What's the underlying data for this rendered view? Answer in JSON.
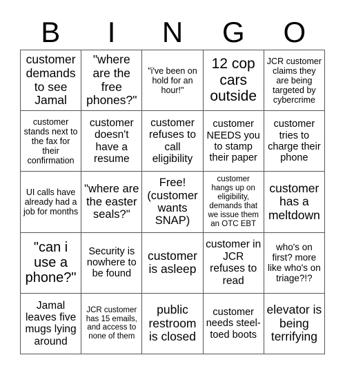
{
  "header": {
    "letters": [
      "B",
      "I",
      "N",
      "G",
      "O"
    ]
  },
  "cells": [
    [
      "customer demands to see Jamal",
      "\"where are the free phones?\"",
      "\"i've been on hold for an hour!\"",
      "12 cop cars outside",
      "JCR customer claims they are being targeted by cybercrime"
    ],
    [
      "customer stands next to the fax for their confirmation",
      "customer doesn't have a resume",
      "customer refuses to call eligibility",
      "customer NEEDS you to stamp their paper",
      "customer tries to charge their phone"
    ],
    [
      "UI calls have already had a job for months",
      "\"where are the easter seals?\"",
      "Free! (customer wants SNAP)",
      "customer hangs up on eligibility, demands that we issue them an OTC EBT",
      "customer has a meltdown"
    ],
    [
      "\"can i use a phone?\"",
      "Security is nowhere to be found",
      "customer is asleep",
      "customer in JCR refuses to read",
      "who's on first? more like who's on triage?!?"
    ],
    [
      "Jamal leaves five mugs lying around",
      "JCR customer has 15 emails, and access to none of them",
      "public restroom is closed",
      "customer needs steel-toed boots",
      "elevator is being terrifying"
    ]
  ],
  "colors": {
    "grid_line": "#555555",
    "text": "#000000",
    "background": "#ffffff"
  }
}
